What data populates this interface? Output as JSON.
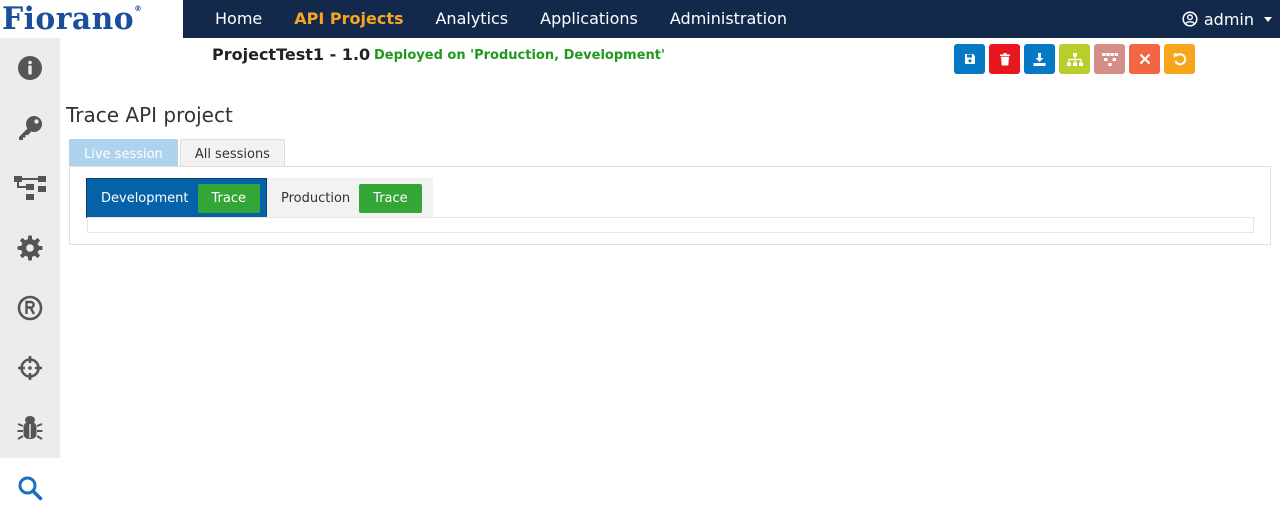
{
  "brand": {
    "logo_text": "Fiorano",
    "logo_mark": "®",
    "logo_color": "#1a4f9c"
  },
  "navbar": {
    "background": "#13294b",
    "active_color": "#f6a623",
    "items": [
      {
        "label": "Home",
        "active": false
      },
      {
        "label": "API Projects",
        "active": true
      },
      {
        "label": "Analytics",
        "active": false
      },
      {
        "label": "Applications",
        "active": false
      },
      {
        "label": "Administration",
        "active": false
      }
    ],
    "user": {
      "label": "admin",
      "icon": "user-circle-icon"
    }
  },
  "sidebar": {
    "items": [
      {
        "icon": "info-circle-icon",
        "active": false
      },
      {
        "icon": "key-icon",
        "active": false
      },
      {
        "icon": "flow-diagram-icon",
        "active": false
      },
      {
        "icon": "gear-icon",
        "active": false
      },
      {
        "icon": "registered-icon",
        "active": false
      },
      {
        "icon": "crosshair-icon",
        "active": false
      },
      {
        "icon": "bug-icon",
        "active": false
      },
      {
        "icon": "search-icon",
        "active": true
      }
    ]
  },
  "project": {
    "title": "ProjectTest1 - 1.0",
    "deploy_status": "Deployed on 'Production, Development'",
    "deploy_color": "#1f9a1f"
  },
  "toolbar": {
    "buttons": [
      {
        "icon": "save-icon",
        "color": "#0679c4"
      },
      {
        "icon": "trash-icon",
        "color": "#e8161e"
      },
      {
        "icon": "download-icon",
        "color": "#0679c4"
      },
      {
        "icon": "sitemap-icon",
        "color": "#b9cd2b"
      },
      {
        "icon": "grid-tree-icon",
        "color": "#d48e86"
      },
      {
        "icon": "close-icon",
        "color": "#f26645"
      },
      {
        "icon": "undo-icon",
        "color": "#f7a51c"
      }
    ]
  },
  "page": {
    "heading": "Trace API project"
  },
  "tabs": [
    {
      "label": "Live session",
      "active": true
    },
    {
      "label": "All sessions",
      "active": false
    }
  ],
  "environments": [
    {
      "label": "Development",
      "button": "Trace",
      "selected": true
    },
    {
      "label": "Production",
      "button": "Trace",
      "selected": false
    }
  ]
}
